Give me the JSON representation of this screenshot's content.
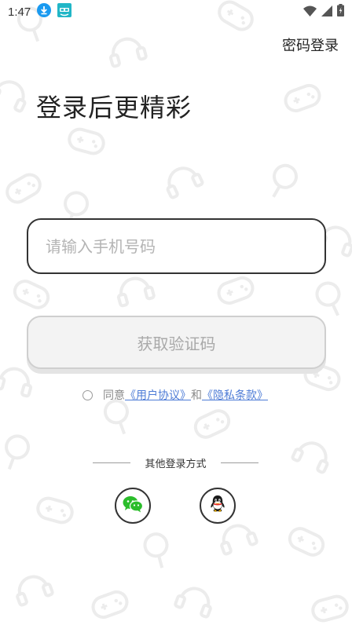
{
  "status_bar": {
    "time": "1:47",
    "icons": [
      "download-icon",
      "app-notification-icon",
      "wifi-icon",
      "signal-icon",
      "battery-icon"
    ]
  },
  "header": {
    "password_login_label": "密码登录"
  },
  "main": {
    "headline": "登录后更精彩",
    "phone_placeholder": "请输入手机号码",
    "get_code_label": "获取验证码"
  },
  "agreement": {
    "prefix": "同意",
    "user_agreement": "《用户协议》",
    "connector": "和",
    "privacy_policy": "《隐私条款》"
  },
  "other_login": {
    "title": "其他登录方式",
    "methods": [
      {
        "icon": "wechat-icon"
      },
      {
        "icon": "qq-icon"
      }
    ]
  },
  "colors": {
    "text": "#222222",
    "placeholder": "#b4b4b4",
    "link": "#4d7bd6",
    "button_bg": "#f3f3f3",
    "wechat_green": "#2bbd2b"
  }
}
